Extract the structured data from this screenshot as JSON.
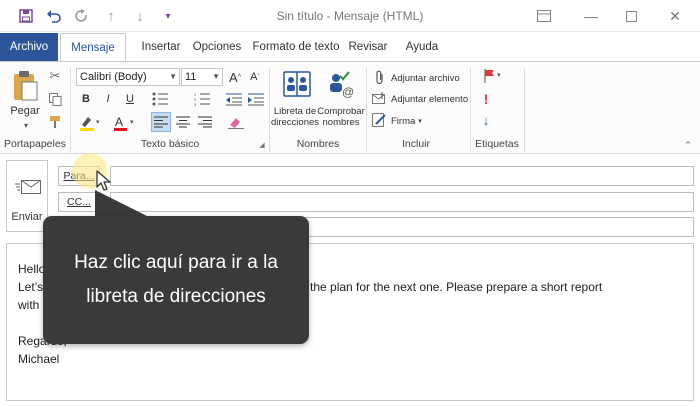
{
  "window": {
    "title": "Sin título - Mensaje (HTML)"
  },
  "quick_access": {
    "icons": [
      "save-icon",
      "undo-icon",
      "redo-icon",
      "up-arrow-icon",
      "down-arrow-icon",
      "customize-icon"
    ]
  },
  "tabs": [
    {
      "label": "Archivo"
    },
    {
      "label": "Mensaje"
    },
    {
      "label": "Insertar"
    },
    {
      "label": "Opciones"
    },
    {
      "label": "Formato de texto"
    },
    {
      "label": "Revisar"
    },
    {
      "label": "Ayuda"
    }
  ],
  "ribbon": {
    "portapapeles": {
      "label": "Portapapeles",
      "paste_label": "Pegar"
    },
    "texto_basico": {
      "label": "Texto básico",
      "font": "Calibri (Body)",
      "size": "11",
      "bold": "B",
      "italic": "I",
      "underline": "U"
    },
    "nombres": {
      "label": "Nombres",
      "address_book_label": "Libreta de direcciones",
      "check_names_label": "Comprobar nombres"
    },
    "incluir": {
      "label": "Incluir",
      "attach_file": "Adjuntar archivo",
      "attach_item": "Adjuntar elemento",
      "signature": "Firma"
    },
    "etiquetas": {
      "label": "Etiquetas"
    }
  },
  "header": {
    "send_label": "Enviar",
    "to_label": "Para...",
    "cc_label": "CC..."
  },
  "body": {
    "lines": [
      "Hello",
      "Let’s",
      "with",
      "Regards,",
      "Michael"
    ],
    "visible_fragment": "d the plan for the next  one. Please prepare a short report"
  },
  "tooltip": {
    "line1": "Haz clic aquí para ir a la",
    "line2": "libreta de direcciones"
  },
  "colors": {
    "accent": "#2b579a",
    "tooltip_bg": "#3a3a3a",
    "highlight": "#ffe682"
  }
}
